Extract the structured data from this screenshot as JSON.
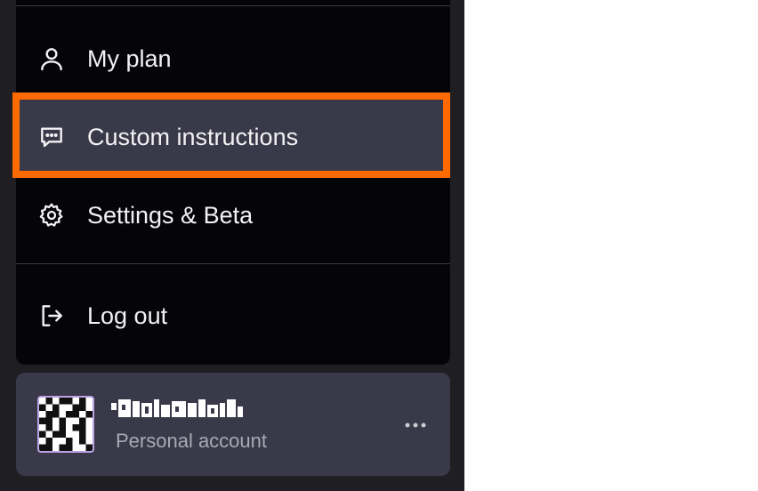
{
  "menu": {
    "items": [
      {
        "label": "My plan",
        "icon": "user-icon"
      },
      {
        "label": "Custom instructions",
        "icon": "message-dots-icon"
      },
      {
        "label": "Settings & Beta",
        "icon": "gear-icon"
      },
      {
        "label": "Log out",
        "icon": "logout-icon"
      }
    ],
    "highlight_color": "#ff6a00"
  },
  "account": {
    "subtitle": "Personal account",
    "more_icon": "more-horizontal-icon"
  },
  "colors": {
    "menu_bg": "#050509",
    "active_bg": "#393949",
    "sidebar_bg": "#1f1f23",
    "text": "#f2f2f4",
    "muted_text": "#a9a9b4"
  }
}
